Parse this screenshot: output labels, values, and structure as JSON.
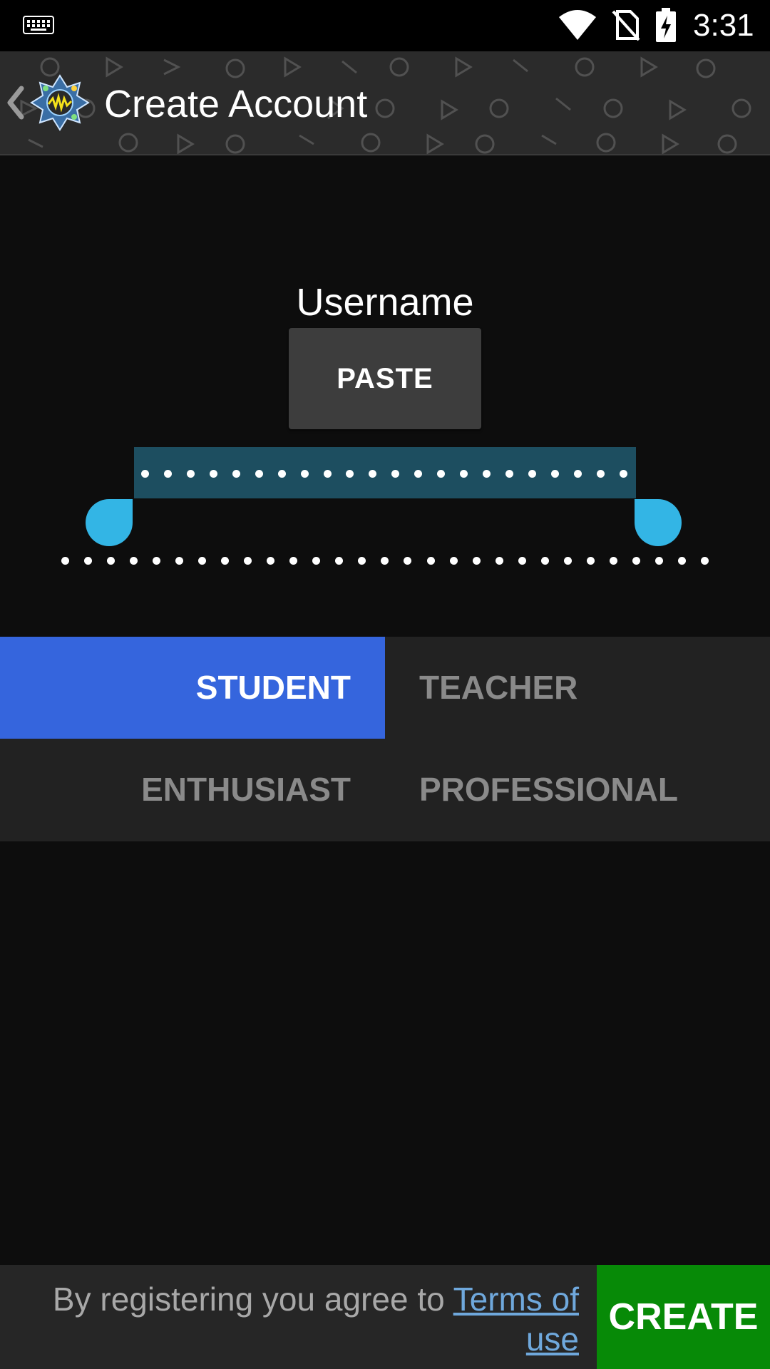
{
  "status_bar": {
    "time": "3:31",
    "icons": [
      "keyboard-icon",
      "wifi-icon",
      "no-sim-icon",
      "battery-charging-icon"
    ]
  },
  "action_bar": {
    "title": "Create Account",
    "icons": [
      "back-chevron-icon",
      "app-logo-icon"
    ]
  },
  "form": {
    "username_label": "Username",
    "paste_label": "PASTE"
  },
  "roles": {
    "selected": "STUDENT",
    "items": [
      {
        "label": "STUDENT"
      },
      {
        "label": "TEACHER"
      },
      {
        "label": "ENTHUSIAST"
      },
      {
        "label": "PROFESSIONAL"
      }
    ]
  },
  "footer": {
    "terms_prefix": "By registering you agree to ",
    "terms_link": "Terms of use",
    "create_label": "CREATE"
  },
  "colors": {
    "background": "#0d0d0d",
    "selected_role": "#3565dd",
    "create_button": "#078a07",
    "selection_handle": "#33b5e5",
    "selection_highlight": "#1d4e60",
    "link": "#6fa8dc"
  }
}
